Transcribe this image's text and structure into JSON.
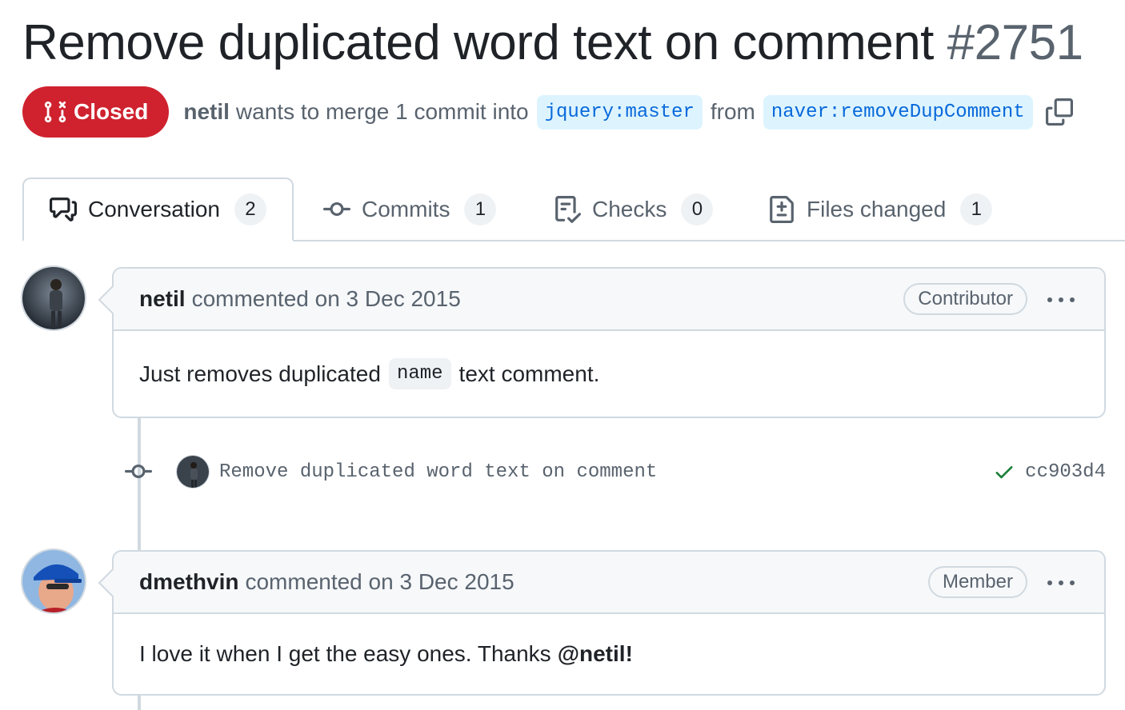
{
  "pr": {
    "title": "Remove duplicated word text on comment",
    "number": "#2751",
    "state_label": "Closed",
    "state_color": "#cf222e",
    "author": "netil",
    "merge_text": "wants to merge 1 commit into",
    "base_branch": "jquery:master",
    "from_text": "from",
    "head_branch": "naver:removeDupComment"
  },
  "tabs": [
    {
      "label": "Conversation",
      "count": "2",
      "icon": "comment-discussion-icon",
      "active": true
    },
    {
      "label": "Commits",
      "count": "1",
      "icon": "git-commit-icon"
    },
    {
      "label": "Checks",
      "count": "0",
      "icon": "checklist-icon"
    },
    {
      "label": "Files changed",
      "count": "1",
      "icon": "file-diff-icon"
    }
  ],
  "comments": [
    {
      "author": "netil",
      "header_text": "commented on 3 Dec 2015",
      "role": "Contributor",
      "body_before": "Just removes duplicated",
      "body_code": "name",
      "body_after": "text comment."
    },
    {
      "author": "dmethvin",
      "header_text": "commented on 3 Dec 2015",
      "role": "Member",
      "body_before": "I love it when I get the easy ones. Thanks",
      "body_mention": "@netil",
      "body_after": "!"
    }
  ],
  "commit": {
    "message": "Remove duplicated word text on comment",
    "sha": "cc903d4",
    "status": "success",
    "status_color": "#1a7f37"
  }
}
